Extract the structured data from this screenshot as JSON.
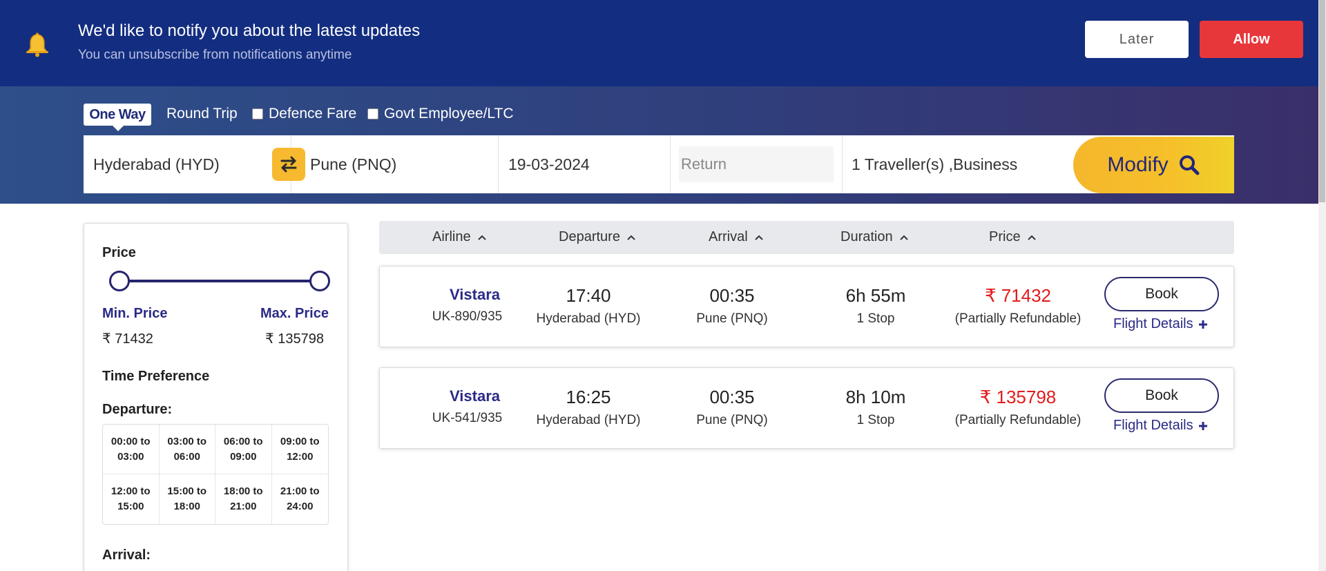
{
  "notification": {
    "title": "We'd like to notify you about the latest updates",
    "subtitle": "You can unsubscribe from notifications anytime",
    "later_label": "Later",
    "allow_label": "Allow",
    "icon": "bell-icon"
  },
  "trip_options": {
    "one_way": "One Way",
    "round_trip": "Round Trip",
    "defence_fare": "Defence Fare",
    "govt_employee": "Govt Employee/LTC"
  },
  "search": {
    "from": "Hyderabad (HYD)",
    "to": "Pune (PNQ)",
    "depart_date": "19-03-2024",
    "return_placeholder": "Return",
    "travellers": "1  Traveller(s) ,Business",
    "modify_label": "Modify"
  },
  "filters": {
    "price_title": "Price",
    "min_label": "Min. Price",
    "max_label": "Max. Price",
    "min_value": "₹ 71432",
    "max_value": "₹ 135798",
    "slider_min_fraction": 0.0,
    "slider_max_fraction": 1.0,
    "time_pref_title": "Time Preference",
    "departure_label": "Departure:",
    "arrival_label": "Arrival:",
    "departure_slots": [
      "00:00 to 03:00",
      "03:00 to 06:00",
      "06:00 to 09:00",
      "09:00 to 12:00",
      "12:00 to 15:00",
      "15:00 to 18:00",
      "18:00 to 21:00",
      "21:00 to 24:00"
    ]
  },
  "sort_headers": {
    "airline": "Airline",
    "departure": "Departure",
    "arrival": "Arrival",
    "duration": "Duration",
    "price": "Price"
  },
  "results": [
    {
      "airline": "Vistara",
      "flight_no": "UK-890/935",
      "dep_time": "17:40",
      "dep_city": "Hyderabad (HYD)",
      "arr_time": "00:35",
      "arr_city": "Pune (PNQ)",
      "duration": "6h 55m",
      "stops": "1 Stop",
      "price": "₹ 71432",
      "refund": "(Partially Refundable)",
      "book_label": "Book",
      "details_label": "Flight Details"
    },
    {
      "airline": "Vistara",
      "flight_no": "UK-541/935",
      "dep_time": "16:25",
      "dep_city": "Hyderabad (HYD)",
      "arr_time": "00:35",
      "arr_city": "Pune (PNQ)",
      "duration": "8h 10m",
      "stops": "1 Stop",
      "price": "₹ 135798",
      "refund": "(Partially Refundable)",
      "book_label": "Book",
      "details_label": "Flight Details"
    }
  ],
  "colors": {
    "notify_bg": "#132d80",
    "allow_red": "#e8373a",
    "accent_navy": "#2a2a86",
    "modify_yellow": "#f5b72c",
    "price_red": "#e21a1a"
  }
}
